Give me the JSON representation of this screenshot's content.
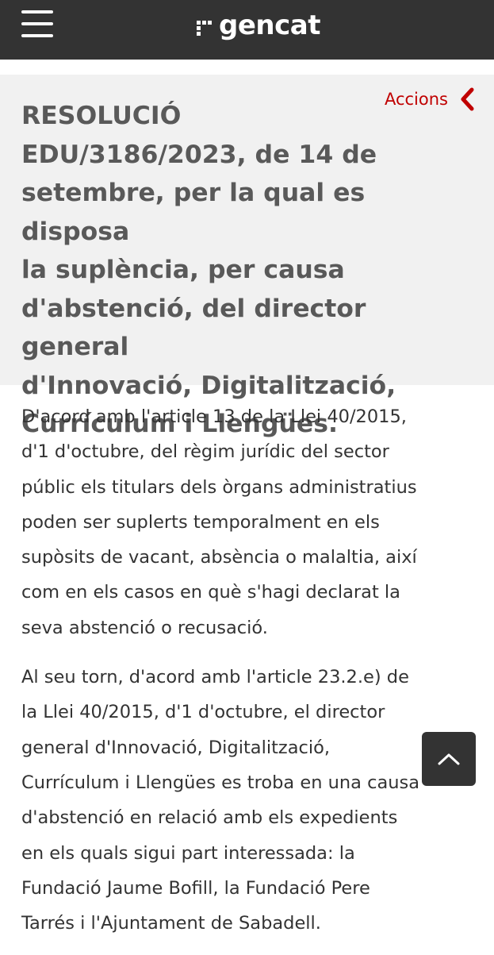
{
  "header": {
    "logo_text": "gencat"
  },
  "document": {
    "actions_label": "Accions",
    "title_lines": [
      "RESOLUCIÓ",
      "EDU/3186/2023, de 14 de",
      "setembre, per la qual es disposa",
      "la suplència, per causa",
      "d'abstenció, del director general",
      "d'Innovació, Digitalització,",
      "Currículum i Llengües."
    ],
    "paragraphs": [
      [
        "D'acord amb l'article 13 de la Llei 40/2015,",
        "d'1 d'octubre, del règim jurídic del sector",
        "públic els titulars dels òrgans administratius",
        "poden ser suplerts temporalment en els",
        "supòsits de vacant, absència o malaltia, així",
        "com en els casos en què s'hagi declarat la",
        "seva abstenció o recusació."
      ],
      [
        "Al seu torn, d'acord amb l'article 23.2.e) de",
        "la Llei 40/2015, d'1 d'octubre, el director",
        "general d'Innovació, Digitalització,",
        "Currículum i Llengües es troba en una causa",
        "d'abstenció en relació amb els expedients",
        "en els quals sigui part interessada: la",
        "Fundació Jaume Bofill, la Fundació Pere",
        "Tarrés i l'Ajuntament de Sabadell."
      ]
    ]
  },
  "colors": {
    "header_bg": "#333333",
    "title_block_bg": "#f1f1f1",
    "title_text": "#595959",
    "accent_red": "#c00000",
    "body_text": "#333333"
  },
  "icons": {
    "menu": "hamburger-menu-icon",
    "logo": "gencat-logo-mark",
    "actions": "chevron-left-icon",
    "back_to_top": "chevron-up-icon"
  }
}
